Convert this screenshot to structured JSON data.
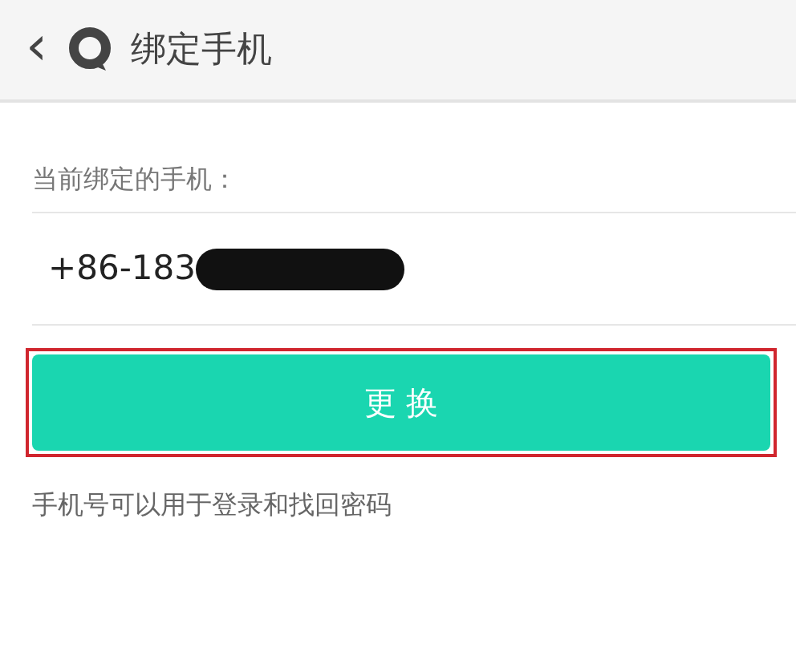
{
  "header": {
    "back": "‹",
    "title": "绑定手机"
  },
  "current_label": "当前绑定的手机：",
  "phone": {
    "value": "+86-183",
    "redacted": true
  },
  "change_button": {
    "label": "更 换",
    "highlighted": true
  },
  "hint": "手机号可以用于登录和找回密码"
}
